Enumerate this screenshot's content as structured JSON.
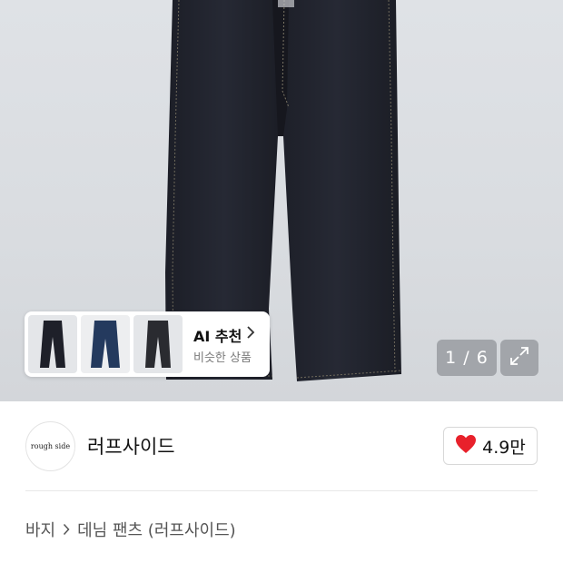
{
  "gallery": {
    "counter": "1 / 6",
    "ai_recommend": {
      "title": "AI 추천",
      "subtitle": "비슷한 상품",
      "thumbnails": [
        "dark-jeans-thumb",
        "blue-jeans-thumb",
        "black-jeans-thumb"
      ]
    }
  },
  "brand": {
    "logo_text": "rough side",
    "name": "러프사이드",
    "likes": "4.9만"
  },
  "breadcrumb": {
    "category": "바지",
    "subcategory": "데님 팬츠 (러프사이드)"
  },
  "colors": {
    "heart": "#e8212b",
    "denim": "#23252f"
  },
  "icons": [
    "chevron-right-icon",
    "expand-icon",
    "heart-icon"
  ]
}
